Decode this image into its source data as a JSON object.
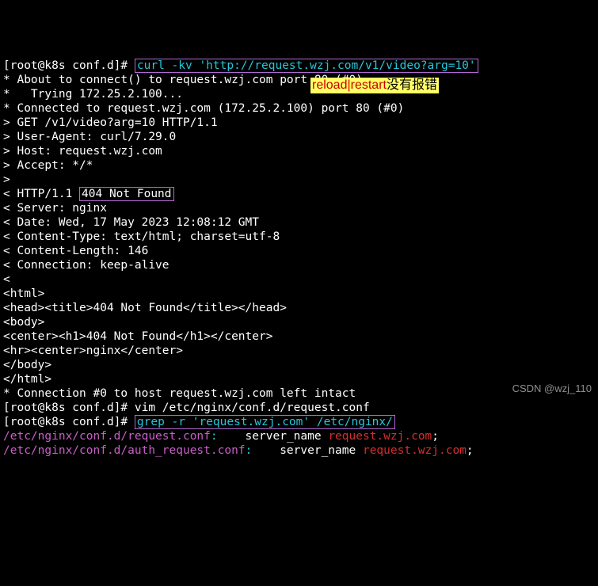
{
  "prompt1": "[root@k8s conf.d]# ",
  "cmd1": "curl -kv 'http://request.wzj.com/v1/video?arg=10'",
  "lines_after_cmd1": [
    "* About to connect() to request.wzj.com port 80 (#0)",
    "*   Trying 172.25.2.100...",
    "* Connected to request.wzj.com (172.25.2.100) port 80 (#0)",
    "> GET /v1/video?arg=10 HTTP/1.1",
    "> User-Agent: curl/7.29.0",
    "> Host: request.wzj.com",
    "> Accept: */*",
    "> ",
    "< HTTP/1.1 "
  ],
  "status_box": "404 Not Found",
  "lines_after_status": [
    "< Server: nginx",
    "< Date: Wed, 17 May 2023 12:08:12 GMT",
    "< Content-Type: text/html; charset=utf-8",
    "< Content-Length: 146",
    "< Connection: keep-alive",
    "< ",
    "<html>",
    "<head><title>404 Not Found</title></head>",
    "<body>",
    "<center><h1>404 Not Found</h1></center>",
    "<hr><center>nginx</center>",
    "</body>",
    "</html>",
    "* Connection #0 to host request.wzj.com left intact"
  ],
  "prompt2": "[root@k8s conf.d]# ",
  "cmd2_plain": "vim /etc/nginx/conf.d/request.conf",
  "prompt3": "[root@k8s conf.d]# ",
  "cmd3": "grep -r 'request.wzj.com' /etc/nginx/",
  "grep1_path": "/etc/nginx/conf.d/request.conf",
  "grep1_colon": ":",
  "grep1_mid": "    server_name ",
  "grep1_host": "request.wzj.com",
  "grep1_semi": ";",
  "grep2_path": "/etc/nginx/conf.d/auth_request.conf",
  "grep2_colon": ":",
  "grep2_mid": "    server_name ",
  "grep2_host": "request.wzj.com",
  "grep2_semi": ";",
  "annot_red": "reload|restart",
  "annot_black": "没有报错",
  "watermark": "CSDN @wzj_110"
}
